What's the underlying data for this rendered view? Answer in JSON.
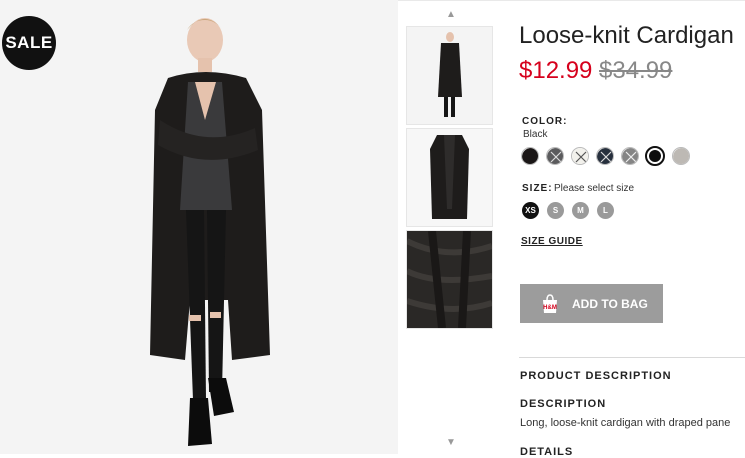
{
  "badge": {
    "sale": "SALE"
  },
  "product": {
    "title": "Loose-knit Cardigan",
    "price_sale": "$12.99",
    "price_original": "$34.99"
  },
  "color": {
    "label": "COLOR:",
    "selected": "Black",
    "swatches": [
      "black",
      "dark-gray-x",
      "white-x",
      "navy-x",
      "gray-x",
      "black-selected",
      "light-gray"
    ]
  },
  "size": {
    "label": "SIZE:",
    "prompt": "Please select size",
    "options": [
      "XS",
      "S",
      "M",
      "L"
    ]
  },
  "size_guide": "SIZE GUIDE",
  "add_to_bag": {
    "label": "ADD TO BAG",
    "icon": "hm-bag-icon"
  },
  "sections": {
    "product_description": "PRODUCT DESCRIPTION",
    "description_heading": "DESCRIPTION",
    "description_text": "Long, loose-knit cardigan with draped pane",
    "details_heading": "DETAILS"
  },
  "colors": {
    "sale_price": "#d6001c",
    "button": "#9c9c9c",
    "badge": "#111111"
  }
}
